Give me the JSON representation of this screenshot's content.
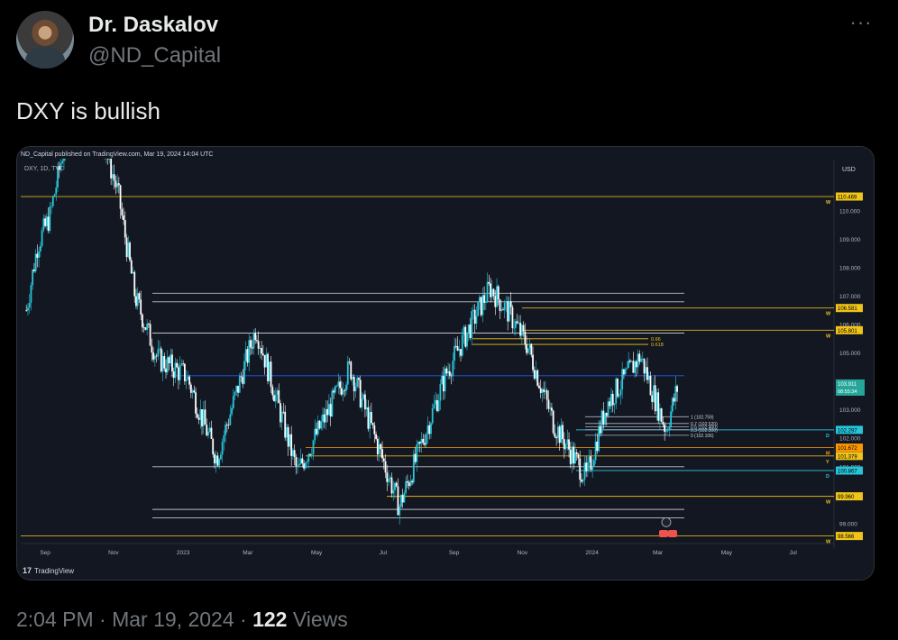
{
  "tweet": {
    "author_name": "Dr. Daskalov",
    "author_handle": "@ND_Capital",
    "more_icon": "more-horizontal-icon",
    "text": "DXY is bullish",
    "time": "2:04 PM",
    "sep1": "·",
    "date": "Mar 19, 2024",
    "sep2": "·",
    "views_count": "122",
    "views_label": "Views"
  },
  "chart_header": {
    "published": "ND_Capital published on TradingView.com, Mar 19, 2024 14:04 UTC",
    "symbol": "DXY, 1D, TVC",
    "currency": "USD",
    "logo_text": "TradingView"
  },
  "colors": {
    "background": "#131722",
    "candle_up": "#26c6da",
    "candle_down": "#ffffff",
    "yellow_line": "#f0c419",
    "white_line": "#d1d4dc",
    "blue_line": "#2962ff"
  },
  "chart_data": {
    "type": "candlestick",
    "symbol": "DXY",
    "timeframe": "1D",
    "y_axis": {
      "ticks": [
        99.0,
        100.0,
        101.0,
        102.0,
        103.0,
        104.0,
        105.0,
        106.0,
        107.0,
        108.0,
        109.0,
        110.0
      ],
      "tick_labels": [
        "99.000",
        "100.000",
        "101.000",
        "102.000",
        "103.000",
        "104.000",
        "105.000",
        "106.000",
        "107.000",
        "108.000",
        "109.000",
        "110.000"
      ],
      "range": [
        98.3,
        111.8
      ]
    },
    "x_axis": {
      "labels": [
        "Sep",
        "Nov",
        "2023",
        "Mar",
        "May",
        "Jul",
        "Sep",
        "Nov",
        "2024",
        "Mar",
        "May",
        "Jul"
      ]
    },
    "price_path": [
      {
        "date": "2022-08-15",
        "price": 106.5
      },
      {
        "date": "2022-08-25",
        "price": 108.8
      },
      {
        "date": "2022-09-05",
        "price": 109.8
      },
      {
        "date": "2022-09-27",
        "price": 114.1
      },
      {
        "date": "2022-10-10",
        "price": 113.0
      },
      {
        "date": "2022-10-20",
        "price": 112.8
      },
      {
        "date": "2022-11-05",
        "price": 110.6
      },
      {
        "date": "2022-11-20",
        "price": 107.0
      },
      {
        "date": "2022-12-10",
        "price": 104.8
      },
      {
        "date": "2023-01-05",
        "price": 104.2
      },
      {
        "date": "2023-02-01",
        "price": 101.3
      },
      {
        "date": "2023-03-08",
        "price": 105.9
      },
      {
        "date": "2023-04-14",
        "price": 100.8
      },
      {
        "date": "2023-05-31",
        "price": 104.5
      },
      {
        "date": "2023-07-14",
        "price": 99.6
      },
      {
        "date": "2023-08-25",
        "price": 104.3
      },
      {
        "date": "2023-10-03",
        "price": 107.3
      },
      {
        "date": "2023-10-20",
        "price": 106.4
      },
      {
        "date": "2023-11-05",
        "price": 105.3
      },
      {
        "date": "2023-11-29",
        "price": 102.5
      },
      {
        "date": "2023-12-28",
        "price": 100.6
      },
      {
        "date": "2024-01-15",
        "price": 103.2
      },
      {
        "date": "2024-02-14",
        "price": 104.9
      },
      {
        "date": "2024-03-08",
        "price": 102.3
      },
      {
        "date": "2024-03-19",
        "price": 103.9
      }
    ],
    "levels": [
      {
        "price": 110.5,
        "color": "#f0c419",
        "label": "110.469",
        "tag": "W"
      },
      {
        "price": 107.1,
        "color": "#d1d4dc"
      },
      {
        "price": 106.8,
        "color": "#d1d4dc"
      },
      {
        "price": 106.581,
        "color": "#f0c419",
        "label": "106.581",
        "tag": "W"
      },
      {
        "price": 105.801,
        "color": "#f0c419",
        "label": "105.801",
        "tag": "W"
      },
      {
        "price": 105.7,
        "color": "#d1d4dc"
      },
      {
        "price": 104.2,
        "color": "#2962ff"
      },
      {
        "price": 102.297,
        "color": "#26c6da",
        "label": "102.297",
        "tag": "D"
      },
      {
        "price": 101.672,
        "color": "#ff9800",
        "label": "101.672",
        "tag": "M"
      },
      {
        "price": 101.379,
        "color": "#f0c419",
        "label": "101.379",
        "tag": "Y"
      },
      {
        "price": 101.0,
        "color": "#d1d4dc"
      },
      {
        "price": 100.867,
        "color": "#26c6da",
        "label": "100.867",
        "tag": "D"
      },
      {
        "price": 99.96,
        "color": "#f0c419",
        "label": "99.960",
        "tag": "W"
      },
      {
        "price": 99.5,
        "color": "#d1d4dc"
      },
      {
        "price": 99.2,
        "color": "#d1d4dc"
      },
      {
        "price": 98.566,
        "color": "#f0c419",
        "label": "98.566",
        "tag": "W"
      }
    ],
    "fib_upper": [
      {
        "level": "0.66",
        "price": 105.5
      },
      {
        "level": "0.618",
        "price": 105.3
      }
    ],
    "fib_lower": [
      {
        "text": "1 (102.759)",
        "price": 102.759
      },
      {
        "text": "0.7 (102.520)",
        "price": 102.52
      },
      {
        "text": "0.5 (102.400)",
        "price": 102.4
      },
      {
        "text": "0.3 (102.300)",
        "price": 102.3
      },
      {
        "text": "0 (102.106)",
        "price": 102.106
      }
    ],
    "last_price": {
      "value": "103.911",
      "countdown": "08:55:34"
    },
    "label_105_8": "105.801",
    "label_106_0": "106.000"
  }
}
